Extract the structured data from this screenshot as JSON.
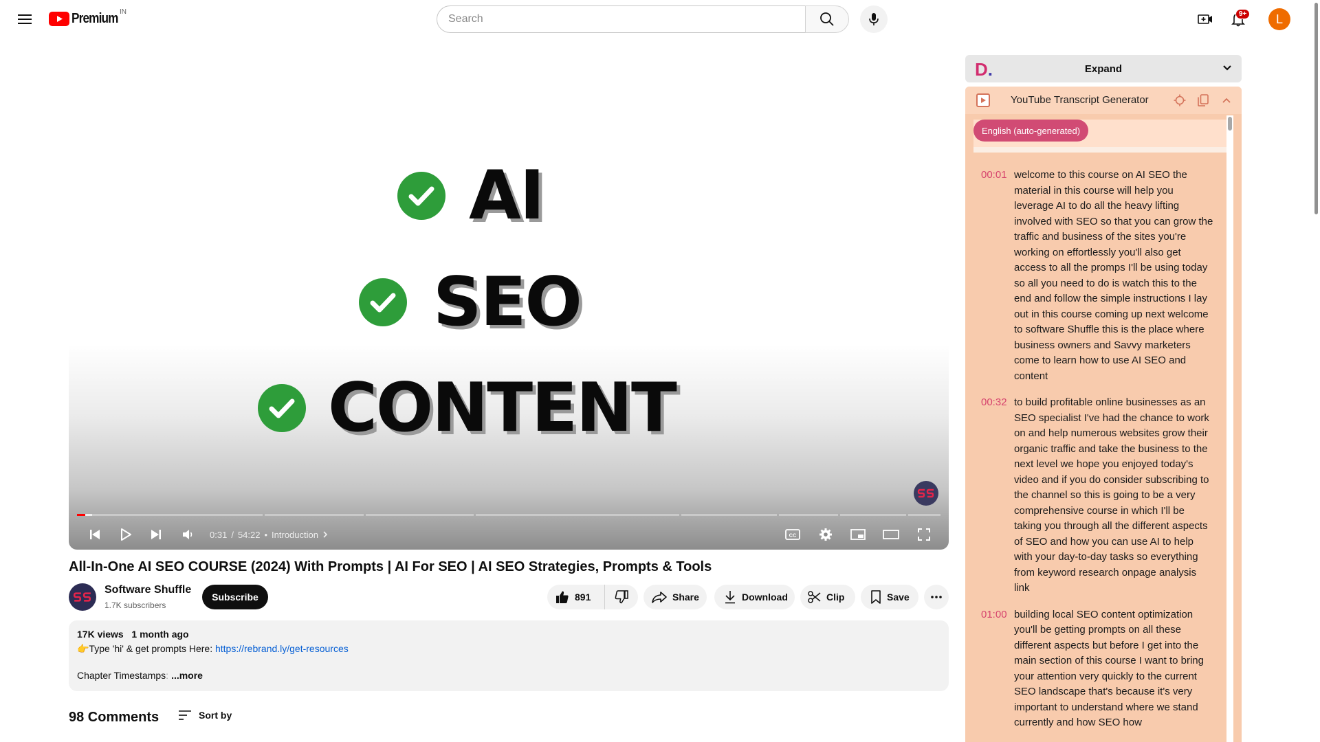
{
  "header": {
    "logo_text": "Premium",
    "country_code": "IN",
    "search_placeholder": "Search",
    "notification_badge": "9+",
    "avatar_letter": "L"
  },
  "player": {
    "slide_words": [
      "AI",
      "SEO",
      "CONTENT"
    ],
    "current_time": "0:31",
    "time_separator": "/",
    "duration": "54:22",
    "chapter_separator": "•",
    "chapter": "Introduction",
    "progress_fraction": 0.0095
  },
  "video": {
    "title": "All-In-One AI SEO COURSE (2024) With Prompts | AI For SEO | AI SEO Strategies, Prompts & Tools",
    "channel_name": "Software Shuffle",
    "subscribers": "1.7K subscribers",
    "subscribe_label": "Subscribe",
    "like_count": "891",
    "share_label": "Share",
    "download_label": "Download",
    "clip_label": "Clip",
    "save_label": "Save"
  },
  "description": {
    "views": "17K views",
    "age": "1 month ago",
    "line_prefix": "👉Type 'hi' & get prompts Here: ",
    "link": "https://rebrand.ly/get-resources",
    "chapter_text_a": "Chapter Timestamps",
    "chapter_text_b": ":",
    "more_label": "...more"
  },
  "comments": {
    "count_label": "98 Comments",
    "sort_label": "Sort by"
  },
  "extension": {
    "logo_letter": "D",
    "logo_dot": ".",
    "expand_label": "Expand",
    "panel_title": "YouTube Transcript Generator",
    "language": "English (auto-generated)",
    "entries": [
      {
        "time": "00:01",
        "text": "welcome to this course on AI SEO the material in this course will help you leverage AI to do all the heavy lifting involved with SEO so that you can grow the traffic and business of the sites you're working on effortlessly you'll also get access to all the promps I'll be using today so all you need to do is watch this to the end and follow the simple instructions I lay out in this course coming up next welcome to software Shuffle this is the place where business owners and Savvy marketers come to learn how to use AI SEO and content"
      },
      {
        "time": "00:32",
        "text": "to build profitable online businesses as an SEO specialist I've had the chance to work on and help numerous websites grow their organic traffic and take the business to the next level we hope you enjoyed today's video and if you do consider subscribing to the channel so this is going to be a very comprehensive course in which I'll be taking you through all the different aspects of SEO and how you can use AI to help with your day-to-day tasks so everything from keyword research onpage analysis link"
      },
      {
        "time": "01:00",
        "text": "building local SEO content optimization you'll be getting prompts on all these different aspects but before I get into the main section of this course I want to bring your attention very quickly to the current SEO landscape that's because it's very important to understand where we stand currently and how SEO how"
      }
    ]
  },
  "colors": {
    "youtube_red": "#ff0000",
    "check_green": "#2e9d3a",
    "panel_bg": "#f8cbad",
    "timestamp": "#d6436d",
    "chip": "#d14b74",
    "link": "#065fd4"
  }
}
